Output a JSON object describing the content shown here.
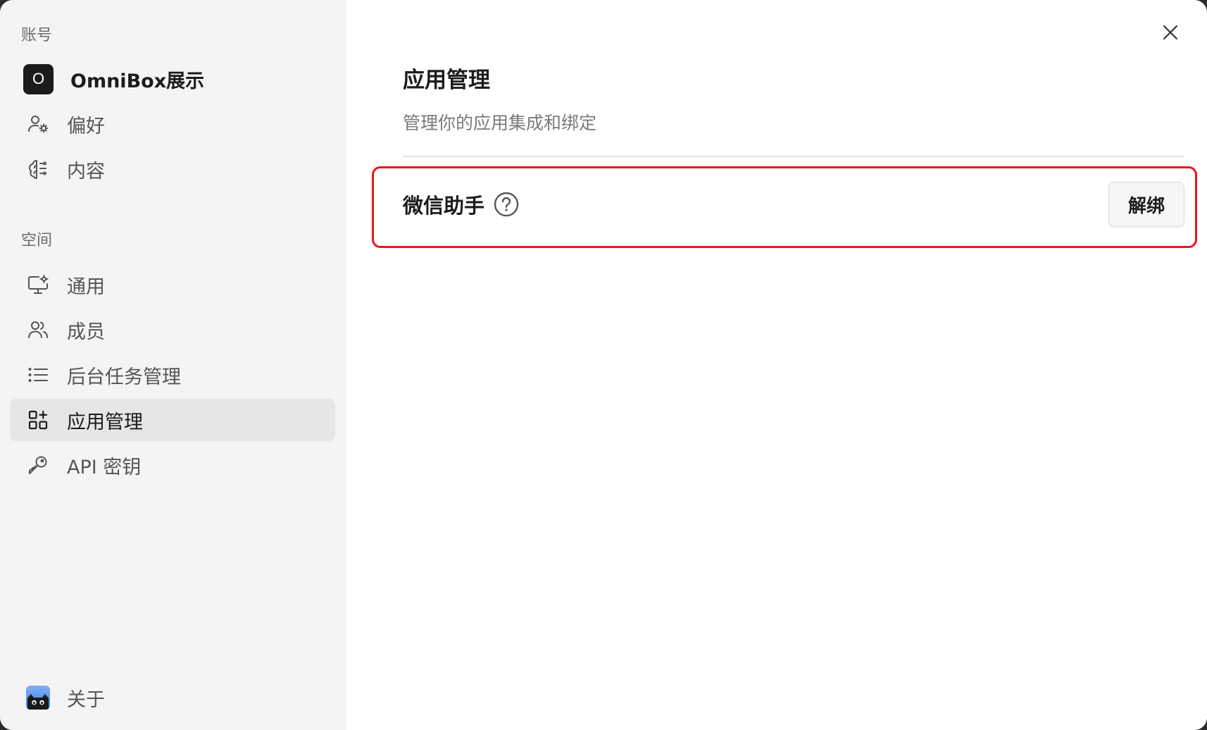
{
  "sidebar": {
    "account_section_label": "账号",
    "account": {
      "avatar_letter": "O",
      "name": "OmniBox展示"
    },
    "account_items": [
      {
        "label": "偏好",
        "icon": "user-settings-icon"
      },
      {
        "label": "内容",
        "icon": "brain-icon"
      }
    ],
    "space_section_label": "空间",
    "space_items": [
      {
        "label": "通用",
        "icon": "monitor-settings-icon"
      },
      {
        "label": "成员",
        "icon": "users-icon"
      },
      {
        "label": "后台任务管理",
        "icon": "list-icon"
      },
      {
        "label": "应用管理",
        "icon": "apps-grid-icon",
        "active": true
      },
      {
        "label": "API 密钥",
        "icon": "key-icon"
      }
    ],
    "about": {
      "label": "关于",
      "icon": "cat-logo-icon"
    }
  },
  "main": {
    "title": "应用管理",
    "subtitle": "管理你的应用集成和绑定",
    "apps": [
      {
        "name": "微信助手",
        "action_label": "解绑"
      }
    ]
  },
  "colors": {
    "sidebar_bg": "#f4f4f4",
    "active_item_bg": "#e6e6e6",
    "highlight_border": "#e8191b"
  }
}
